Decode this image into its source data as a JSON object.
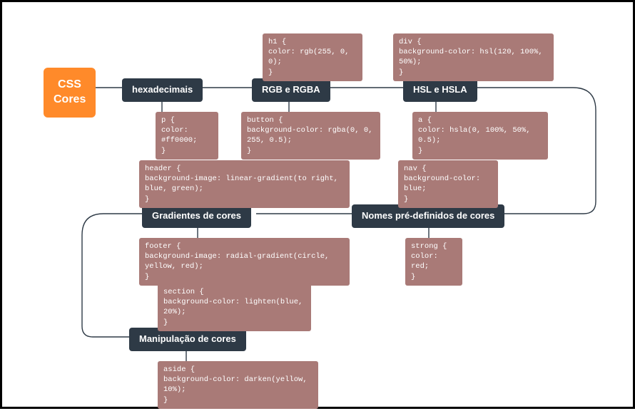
{
  "root": {
    "label": "CSS\nCores"
  },
  "branches": {
    "hex": {
      "label": "hexadecimais"
    },
    "rgb": {
      "label": "RGB e RGBA"
    },
    "hsl": {
      "label": "HSL e HSLA"
    },
    "names": {
      "label": "Nomes pré-definidos de cores"
    },
    "gradients": {
      "label": "Gradientes de cores"
    },
    "manip": {
      "label": "Manipulação de cores"
    }
  },
  "leaves": {
    "hex_below": "p {\n  color: #ff0000;\n}",
    "rgb_above": "h1 {\n  color: rgb(255, 0, 0);\n}",
    "rgb_below": "button {\n  background-color: rgba(0, 0, 255, 0.5);\n}",
    "hsl_above": "div {\n  background-color: hsl(120, 100%, 50%);\n}",
    "hsl_below": "a {\n  color: hsla(0, 100%, 50%, 0.5);\n}",
    "names_above": "nav {\n  background-color: blue;\n}",
    "names_below": "strong {\n  color: red;\n}",
    "gradients_above": "header {\n  background-image: linear-gradient(to right, blue, green);\n}",
    "gradients_below": "footer {\n  background-image: radial-gradient(circle, yellow, red);\n}",
    "manip_above": "section {\n  background-color: lighten(blue, 20%);\n}",
    "manip_below": "aside {\n  background-color: darken(yellow, 10%);\n}"
  }
}
